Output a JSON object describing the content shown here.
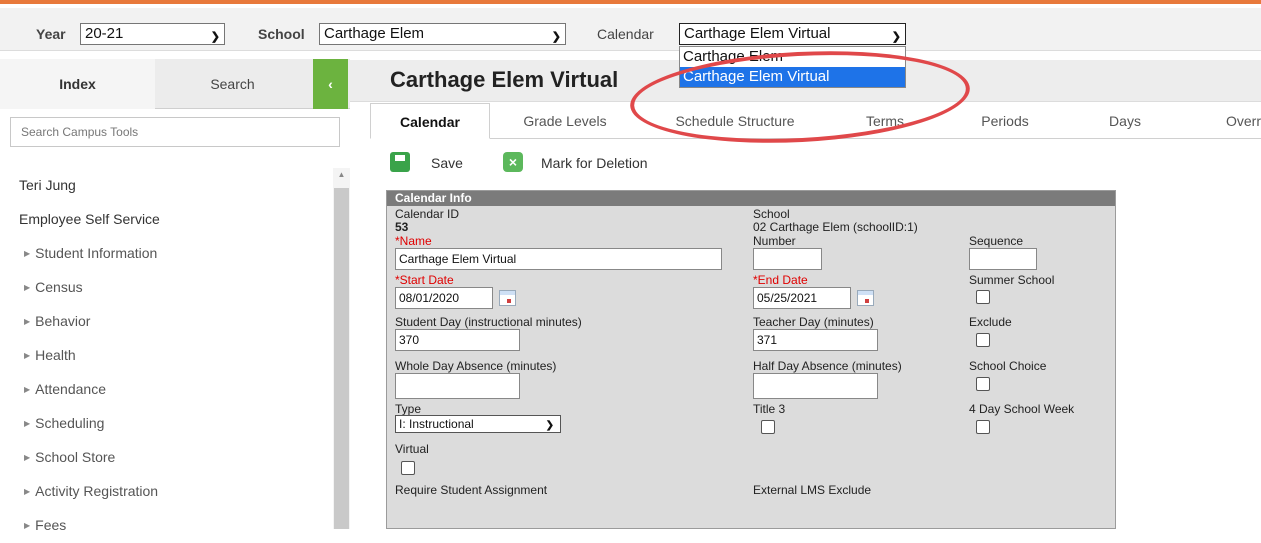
{
  "header": {
    "year_label": "Year",
    "year_value": "20-21",
    "school_label": "School",
    "school_value": "Carthage Elem",
    "calendar_label": "Calendar",
    "calendar_value": "Carthage Elem Virtual",
    "calendar_options": [
      {
        "label": "Carthage Elem",
        "selected": false
      },
      {
        "label": "Carthage Elem Virtual",
        "selected": true
      }
    ]
  },
  "sidebar": {
    "tab_index": "Index",
    "tab_search": "Search",
    "search_placeholder": "Search Campus Tools",
    "items": [
      {
        "label": "Teri Jung"
      },
      {
        "label": "Employee Self Service"
      },
      {
        "label": "Student Information"
      },
      {
        "label": "Census"
      },
      {
        "label": "Behavior"
      },
      {
        "label": "Health"
      },
      {
        "label": "Attendance"
      },
      {
        "label": "Scheduling"
      },
      {
        "label": "School Store"
      },
      {
        "label": "Activity Registration"
      },
      {
        "label": "Fees"
      }
    ]
  },
  "main": {
    "title": "Carthage Elem Virtual",
    "tabs": [
      "Calendar",
      "Grade Levels",
      "Schedule Structure",
      "Terms",
      "Periods",
      "Days",
      "Overr"
    ],
    "save_label": "Save",
    "delete_label": "Mark for Deletion"
  },
  "form": {
    "panel_title": "Calendar Info",
    "calendar_id_label": "Calendar ID",
    "calendar_id_value": "53",
    "school_label": "School",
    "school_value": "02 Carthage Elem (schoolID:1)",
    "name_label": "*Name",
    "name_value": "Carthage Elem Virtual",
    "number_label": "Number",
    "number_value": "",
    "sequence_label": "Sequence",
    "sequence_value": "",
    "start_date_label": "*Start Date",
    "start_date_value": "08/01/2020",
    "end_date_label": "*End Date",
    "end_date_value": "05/25/2021",
    "summer_school_label": "Summer School",
    "student_day_label": "Student Day (instructional minutes)",
    "student_day_value": "370",
    "teacher_day_label": "Teacher Day (minutes)",
    "teacher_day_value": "371",
    "exclude_label": "Exclude",
    "whole_day_label": "Whole Day Absence (minutes)",
    "whole_day_value": "",
    "half_day_label": "Half Day Absence (minutes)",
    "half_day_value": "",
    "school_choice_label": "School Choice",
    "type_label": "Type",
    "type_value": "I: Instructional",
    "title3_label": "Title 3",
    "four_day_label": "4 Day School Week",
    "virtual_label": "Virtual",
    "require_assignment_label": "Require Student Assignment",
    "external_lms_label": "External LMS Exclude"
  },
  "colors": {
    "accent_orange": "#e8793b",
    "green": "#6cb33f",
    "selection_blue": "#1e73e8",
    "required_red": "#e00000",
    "annotation_red": "#e0484a"
  }
}
